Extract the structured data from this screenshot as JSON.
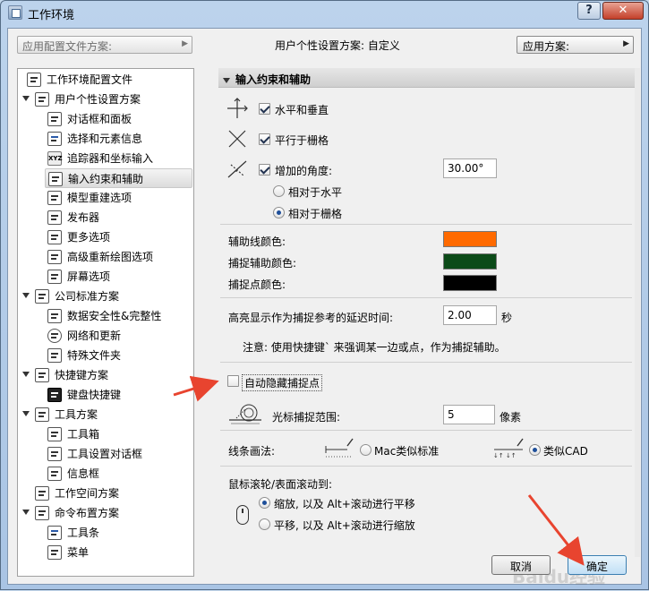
{
  "window": {
    "title": "工作环境",
    "help_label": "?",
    "close_label": "✕"
  },
  "top": {
    "profile_dropdown_placeholder": "应用配置文件方案:",
    "profile_scheme_text": "用户个性设置方案:  自定义",
    "apply_scheme_label": "应用方案:"
  },
  "tree": {
    "items": [
      {
        "label": "工作环境配置文件",
        "icon": "profile-icon"
      },
      {
        "label": "用户个性设置方案",
        "icon": "user-scheme-icon"
      },
      {
        "label": "对话框和面板",
        "icon": "dialog-icon"
      },
      {
        "label": "选择和元素信息",
        "icon": "selection-icon"
      },
      {
        "label": "追踪器和坐标输入",
        "icon": "xyz-icon"
      },
      {
        "label": "输入约束和辅助",
        "icon": "cursor-icon"
      },
      {
        "label": "模型重建选项",
        "icon": "model-icon"
      },
      {
        "label": "发布器",
        "icon": "publisher-icon"
      },
      {
        "label": "更多选项",
        "icon": "options-icon"
      },
      {
        "label": "高级重新绘图选项",
        "icon": "redraw-icon"
      },
      {
        "label": "屏幕选项",
        "icon": "screen-icon"
      },
      {
        "label": "公司标准方案",
        "icon": "company-icon"
      },
      {
        "label": "数据安全性&完整性",
        "icon": "data-safety-icon"
      },
      {
        "label": "网络和更新",
        "icon": "globe-icon"
      },
      {
        "label": "特殊文件夹",
        "icon": "folder-icon"
      },
      {
        "label": "快捷键方案",
        "icon": "shortcut-icon"
      },
      {
        "label": "键盘快捷键",
        "icon": "keyboard-icon"
      },
      {
        "label": "工具方案",
        "icon": "tool-scheme-icon"
      },
      {
        "label": "工具箱",
        "icon": "toolbox-icon"
      },
      {
        "label": "工具设置对话框",
        "icon": "tool-settings-icon"
      },
      {
        "label": "信息框",
        "icon": "infobox-icon"
      },
      {
        "label": "工作空间方案",
        "icon": "workspace-icon"
      },
      {
        "label": "命令布置方案",
        "icon": "command-icon"
      },
      {
        "label": "工具条",
        "icon": "toolbar-icon"
      },
      {
        "label": "菜单",
        "icon": "menu-icon"
      }
    ]
  },
  "panel": {
    "header": "输入约束和辅助",
    "horizontal_vertical": "水平和垂直",
    "parallel_grid": "平行于栅格",
    "extra_angle": "增加的角度:",
    "extra_angle_value": "30.00°",
    "relative_horizontal": "相对于水平",
    "relative_grid": "相对于栅格",
    "guide_line_color": "辅助线颜色:",
    "snap_guide_color": "捕捉辅助颜色:",
    "snap_point_color": "捕捉点颜色:",
    "delay_label": "高亮显示作为捕捉参考的延迟时间:",
    "delay_value": "2.00",
    "delay_unit": "秒",
    "note": "注意: 使用快捷键` 来强调某一边或点，作为捕捉辅助。",
    "auto_hide": "自动隐藏捕捉点",
    "cursor_range_label": "光标捕捉范围:",
    "cursor_range_value": "5",
    "cursor_range_unit": "像素",
    "line_drawing_label": "线条画法:",
    "mac_standard": "Mac类似标准",
    "cad_like": "类似CAD",
    "scroll_label": "鼠标滚轮/表面滚动到:",
    "scroll_zoom": "缩放, 以及 Alt+滚动进行平移",
    "scroll_pan": "平移, 以及 Alt+滚动进行缩放"
  },
  "colors": {
    "guide_line": "#ff6a00",
    "snap_guide": "#0b4a18",
    "snap_point": "#000000",
    "annotation_arrow": "#e8442f"
  },
  "buttons": {
    "cancel": "取消",
    "ok": "确定"
  },
  "watermark": "Baidu经验"
}
